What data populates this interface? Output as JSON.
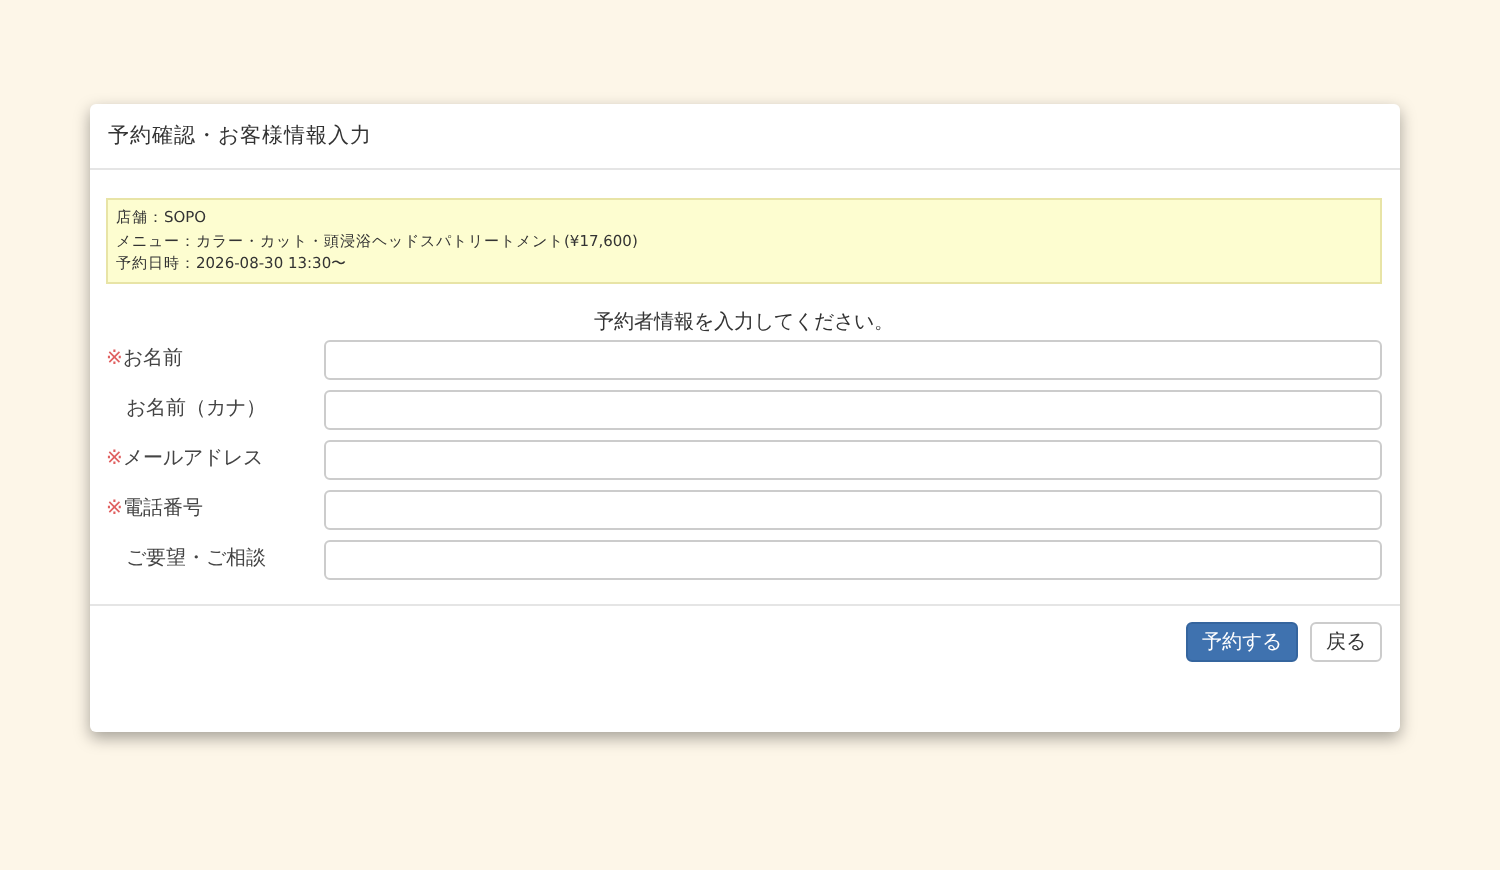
{
  "card": {
    "title": "予約確認・お客様情報入力"
  },
  "summary": [
    "店舗：SOPO",
    "メニュー：カラー・カット・頭浸浴ヘッドスパトリートメント(¥17,600)",
    "予約日時：2026-08-30 13:30〜"
  ],
  "form": {
    "heading": "予約者情報を入力してください。",
    "fields": [
      {
        "mark": "※",
        "label": "お名前"
      },
      {
        "label": "お名前（カナ）"
      },
      {
        "mark": "※",
        "label": "メールアドレス"
      },
      {
        "mark": "※",
        "label": "電話番号"
      },
      {
        "label": "ご要望・ご相談"
      }
    ]
  },
  "buttons": [
    {
      "label": "予約する",
      "kind": "primary"
    },
    {
      "label": "戻る",
      "kind": "default"
    }
  ]
}
